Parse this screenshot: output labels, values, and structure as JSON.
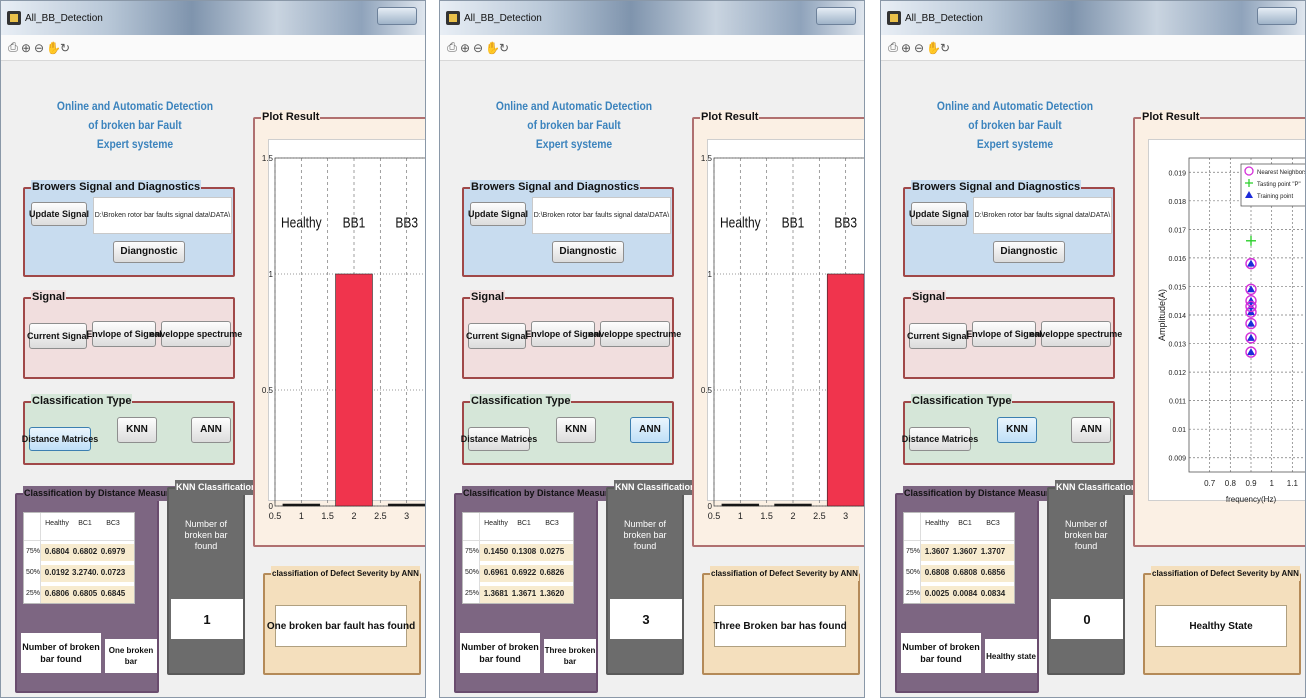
{
  "app": {
    "title": "All_BB_Detection",
    "toolbar_icons": [
      "print-icon",
      "zoom-in-icon",
      "zoom-out-icon",
      "pan-icon",
      "rotate-icon"
    ]
  },
  "common": {
    "heading_lines": [
      "Online and Automatic  Detection",
      "of broken bar  Fault",
      "Expert systeme"
    ],
    "browse_title": "Browers Signal and Diagnostics",
    "update_label": "Update Signal",
    "path_text": "D:\\Broken rotor bar faults signal  data\\DATA\\",
    "diag_label": "Diangnostic",
    "signal_title": "Signal",
    "current_label": "Current Signal",
    "envelope_label": "Envlope of Signal",
    "spectrum_label": "enveloppe spectrume",
    "class_title": "Classification Type",
    "distance_label": "Distance Matrices",
    "knn_label": "KNN",
    "ann_label": "ANN",
    "dist_title": "Classification by Distance Measure",
    "col_headers": [
      "Healthy",
      "BC1",
      "BC3"
    ],
    "row_labels": [
      "75%",
      "50%",
      "25%"
    ],
    "broken_label": "Number of broken bar found",
    "knn_title": "KNN Classification",
    "knn_caption": "Number of broken bar found",
    "plot_title": "Plot Result",
    "ann_title": "classifiation of Defect Severity  by ANN"
  },
  "windows": [
    {
      "selected": "distance",
      "table": [
        [
          "0.6804",
          "0.6802",
          "0.6979"
        ],
        [
          "0.0192",
          "3.2740...",
          "0.0723"
        ],
        [
          "0.6806",
          "0.6805",
          "0.6845"
        ]
      ],
      "broken_value": "One broken bar",
      "knn_value": "1",
      "ann_result": "One broken bar fault has found"
    },
    {
      "selected": "ann",
      "table": [
        [
          "0.1450",
          "0.1308",
          "0.0275"
        ],
        [
          "0.6961",
          "0.6922",
          "0.6826"
        ],
        [
          "1.3681",
          "1.3671",
          "1.3620"
        ]
      ],
      "broken_value": "Three broken bar",
      "knn_value": "3",
      "ann_result": "Three Broken bar has found"
    },
    {
      "selected": "knn",
      "table": [
        [
          "1.3607",
          "1.3607",
          "1.3707"
        ],
        [
          "0.6808",
          "0.6808",
          "0.6856"
        ],
        [
          "0.0025",
          "0.0084",
          "0.0834"
        ]
      ],
      "broken_value": "Healthy state",
      "knn_value": "0",
      "ann_result": "Healthy State"
    }
  ],
  "chart_data": [
    {
      "type": "bar",
      "categories": [
        "Healthy",
        "BB1",
        "BB3"
      ],
      "x": [
        1,
        2,
        3
      ],
      "values": [
        0,
        1,
        0
      ],
      "xlim": [
        0.5,
        3.5
      ],
      "ylim": [
        0,
        1.5
      ],
      "xticks": [
        "0.5",
        "1",
        "1.5",
        "2",
        "2.5",
        "3",
        "3.5"
      ],
      "yticks": [
        "0",
        "0.5",
        "1",
        "1.5"
      ],
      "grid": "x dashed, y dotted",
      "bar_color": "#f0344d"
    },
    {
      "type": "bar",
      "categories": [
        "Healthy",
        "BB1",
        "BB3"
      ],
      "x": [
        1,
        2,
        3
      ],
      "values": [
        0,
        0,
        1
      ],
      "xlim": [
        0.5,
        3.5
      ],
      "ylim": [
        0,
        1.5
      ],
      "xticks": [
        "0.5",
        "1",
        "1.5",
        "2",
        "2.5",
        "3",
        "3.5"
      ],
      "yticks": [
        "0",
        "0.5",
        "1",
        "1.5"
      ],
      "grid": "x dashed, y dotted",
      "bar_color": "#f0344d"
    },
    {
      "type": "scatter",
      "xlabel": "frequency(Hz)",
      "ylabel": "Amplitude(A)",
      "xlim": [
        0.6,
        1.2
      ],
      "ylim": [
        0.0085,
        0.0195
      ],
      "xticks": [
        "0.7",
        "0.8",
        "0.9",
        "1",
        "1.1",
        "1.2"
      ],
      "yticks": [
        "0.009",
        "0.01",
        "0.011",
        "0.012",
        "0.013",
        "0.014",
        "0.015",
        "0.016",
        "0.017",
        "0.018",
        "0.019"
      ],
      "legend": [
        "Nearest Neighbors",
        "Tasting point \"P\"",
        "Training point"
      ],
      "legend_position": "top-right",
      "series": [
        {
          "name": "Training point",
          "marker": "triangle",
          "color": "#1c2bd9",
          "x": [
            0.9,
            0.9,
            0.9,
            0.9,
            0.9,
            0.9,
            0.9,
            0.9
          ],
          "y": [
            0.0158,
            0.0149,
            0.0145,
            0.0143,
            0.0141,
            0.0137,
            0.0132,
            0.0127
          ]
        },
        {
          "name": "Nearest Neighbors",
          "marker": "circle",
          "color": "#d430d9",
          "x": [
            0.9,
            0.9,
            0.9,
            0.9,
            0.9,
            0.9,
            0.9,
            0.9
          ],
          "y": [
            0.0158,
            0.0149,
            0.0145,
            0.0143,
            0.0141,
            0.0137,
            0.0132,
            0.0127
          ]
        },
        {
          "name": "Tasting point \"P\"",
          "marker": "plus",
          "color": "#2fd12f",
          "x": [
            0.9
          ],
          "y": [
            0.0166
          ]
        }
      ]
    }
  ]
}
